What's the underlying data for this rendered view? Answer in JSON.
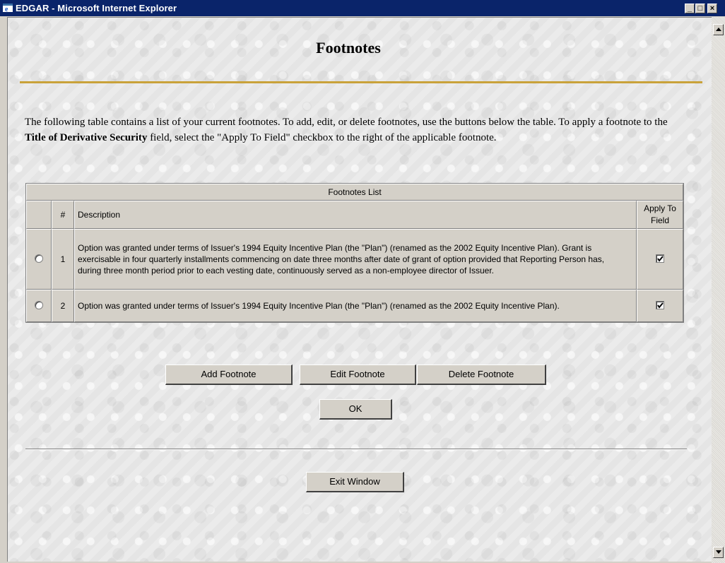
{
  "window": {
    "title": "EDGAR - Microsoft Internet Explorer",
    "minimize_label": "_",
    "maximize_label": "□",
    "close_label": "×"
  },
  "page": {
    "heading": "Footnotes",
    "intro": {
      "part1": "The following table contains a list of your current footnotes. To add, edit, or delete footnotes, use the buttons below the table. To apply a footnote to the ",
      "bold_field": "Title of Derivative Security",
      "part2": " field, select the \"Apply To Field\" checkbox to the right of the applicable footnote."
    }
  },
  "footnotes_table": {
    "caption": "Footnotes List",
    "headers": {
      "number": "#",
      "description": "Description",
      "apply": "Apply To Field"
    },
    "rows": [
      {
        "number": "1",
        "description": "Option was granted under terms of Issuer's 1994 Equity Incentive Plan (the \"Plan\") (renamed as the 2002 Equity Incentive Plan). Grant is exercisable in four quarterly installments commencing on date three months after date of grant of option provided that Reporting Person has, during three month period prior to each vesting date, continuously served as a non-employee director of Issuer.",
        "selected": false,
        "apply_checked": true
      },
      {
        "number": "2",
        "description": "Option was granted under terms of Issuer's 1994 Equity Incentive Plan (the \"Plan\") (renamed as the 2002 Equity Incentive Plan).",
        "selected": false,
        "apply_checked": true
      }
    ]
  },
  "buttons": {
    "add": "Add Footnote",
    "edit": "Edit Footnote",
    "delete": "Delete Footnote",
    "ok": "OK",
    "exit": "Exit Window"
  },
  "icons": {
    "browser": "internet-explorer-icon",
    "scroll_up": "arrow-up-icon",
    "scroll_down": "arrow-down-icon",
    "check": "checkmark-icon"
  },
  "colors": {
    "titlebar": "#0a246a",
    "gold_rule": "#c9a23a",
    "face": "#d4d0c8"
  }
}
